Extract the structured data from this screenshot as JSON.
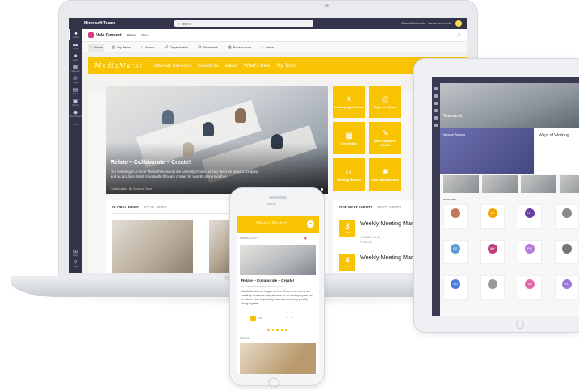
{
  "teams": {
    "app_title": "Microsoft Teams",
    "search_placeholder": "Search",
    "user": "Elias Mühlenhöfe · Vanderbeek Unit",
    "rail": [
      "Activity",
      "Chat",
      "Teams",
      "Calendar",
      "Calls",
      "Files",
      "Yammer",
      "Valo Connect"
    ],
    "rail_bottom": [
      "Apps",
      "Help"
    ],
    "app_name": "Valo Connect",
    "tabs": [
      "Home",
      "About"
    ],
    "commands": [
      "Home",
      "My News",
      "Search",
      "Organization",
      "Teamwork",
      "Book a room",
      "Ideas"
    ]
  },
  "site": {
    "logo": "MediaMarkt",
    "nav": [
      "Internal Services",
      "About Us",
      "Ideas",
      "What's New",
      "My Tools"
    ],
    "hero": {
      "title": "Relate – Collaborate – Create!",
      "text": "Our new slogan is here! These three words are carefully chosen as they describe us as a company and as a culture. Most importantly, they are chosen by you! By doing together",
      "meta": "Collaboration · By Suzanne Grant"
    },
    "tiles": [
      {
        "label": "Holiday Application",
        "icon": "sun-icon"
      },
      {
        "label": "Expense Claim",
        "icon": "coins-icon"
      },
      {
        "label": "Event Hub",
        "icon": "calendar-icon"
      },
      {
        "label": "New Employee Toolkit",
        "icon": "tool-icon"
      },
      {
        "label": "Meeting Rooms",
        "icon": "meeting-icon"
      },
      {
        "label": "Idea Management",
        "icon": "lightbulb-icon"
      }
    ],
    "news_tabs": [
      "GLOBAL NEWS",
      "LOCAL NEWS"
    ],
    "event_tabs": [
      "OUR NEXT EVENTS",
      "PAST EVENTS"
    ],
    "events": [
      {
        "day": "3",
        "month": "OCT",
        "title": "Weekly Meeting Marketing",
        "time": "13:00 - 14:00",
        "room": "B12-16"
      },
      {
        "day": "4",
        "month": "OCT",
        "title": "Weekly Meeting Marketing",
        "time": "",
        "room": ""
      }
    ]
  },
  "phone": {
    "top_label": "MEDIA",
    "logo": "MediaMarkt",
    "section": "HIGHLIGHTS",
    "card_title": "Relate – Collaborate – Create!",
    "card_meta": "Sep 28, 2018 3:30 PM · Suzanne Grant",
    "card_text": "MediaMarkt's new slogan is here! These three words are carefully chosen as they describe us as a company and as a culture. Most importantly, they are chosen by you! By doing together ...",
    "likes": "15",
    "comments": "6",
    "section2": "NEWS"
  },
  "tablet": {
    "hero_title": "Teamwork",
    "ways_title": "Ways of Working",
    "ways_title2": "Ways of Working",
    "members_title": "Group Sites",
    "cards": [
      {
        "initials": "",
        "color": "#c47a5a"
      },
      {
        "initials": "Ex",
        "color": "#f0a500"
      },
      {
        "initials": "GT",
        "color": "#6b3fa0"
      },
      {
        "initials": "",
        "color": "#888888"
      },
      {
        "initials": "CE",
        "color": "#5b9bd5"
      },
      {
        "initials": "MY",
        "color": "#c43b7a"
      },
      {
        "initials": "PC",
        "color": "#b57bd6"
      },
      {
        "initials": "",
        "color": "#777777"
      },
      {
        "initials": "SG",
        "color": "#4e7dd8"
      },
      {
        "initials": "",
        "color": "#999999"
      },
      {
        "initials": "VE",
        "color": "#e06aa8"
      },
      {
        "initials": "VO",
        "color": "#9b7ad6"
      }
    ]
  },
  "colors": {
    "brand_yellow": "#f8c300",
    "teams_dark": "#33344a",
    "teams_accent": "#6264a7"
  }
}
